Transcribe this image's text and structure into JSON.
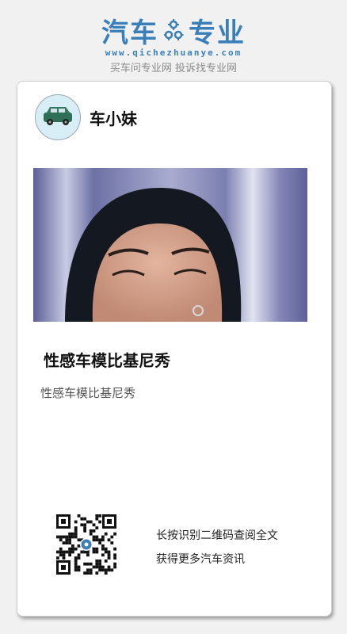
{
  "header": {
    "logo_left": "汽车",
    "logo_right": "专业",
    "logo_url": "www.qichezhuanye.com",
    "slogan": "买车问专业网 投诉找专业网"
  },
  "card": {
    "author_name": "车小妹",
    "article_title": "性感车模比基尼秀",
    "article_summary": "性感车模比基尼秀",
    "qr_line1": "长按识别二维码查阅全文",
    "qr_line2": "获得更多汽车资讯"
  },
  "colors": {
    "brand": "#3a7fb8",
    "background": "#f1f1f1",
    "card": "#ffffff"
  },
  "icons": {
    "logo_gear": "gear-icon",
    "avatar": "car-avatar"
  }
}
